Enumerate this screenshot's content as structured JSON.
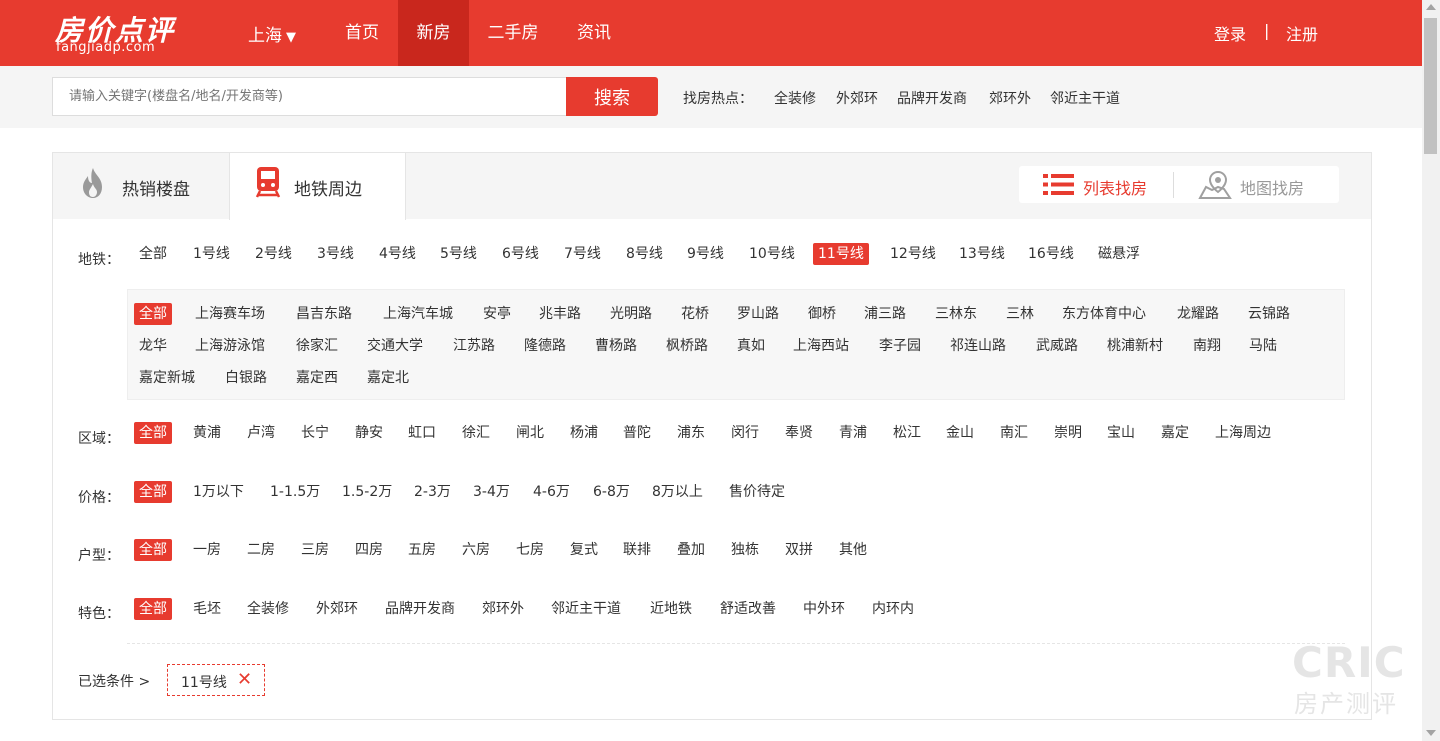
{
  "header": {
    "logo_cn": "房价点评",
    "logo_en": "fangjiadp.com",
    "city": "上海",
    "nav": [
      "首页",
      "新房",
      "二手房",
      "资讯"
    ],
    "login": "登录",
    "separator": "|",
    "register": "注册"
  },
  "search": {
    "placeholder": "请输入关键字(楼盘名/地名/开发商等)",
    "button": "搜索",
    "hot_label": "找房热点：",
    "hot_items": [
      "全装修",
      "外郊环",
      "品牌开发商",
      "郊环外",
      "邻近主干道"
    ]
  },
  "tabs": {
    "hot": "热销楼盘",
    "metro": "地铁周边",
    "list_view": "列表找房",
    "map_view": "地图找房"
  },
  "filters": {
    "metro_label": "地铁：",
    "metro_lines": [
      "全部",
      "1号线",
      "2号线",
      "3号线",
      "4号线",
      "5号线",
      "6号线",
      "7号线",
      "8号线",
      "9号线",
      "10号线",
      "11号线",
      "12号线",
      "13号线",
      "16号线",
      "磁悬浮"
    ],
    "stations": [
      "全部",
      "上海赛车场",
      "昌吉东路",
      "上海汽车城",
      "安亭",
      "兆丰路",
      "光明路",
      "花桥",
      "罗山路",
      "御桥",
      "浦三路",
      "三林东",
      "三林",
      "东方体育中心",
      "龙耀路",
      "云锦路",
      "龙华",
      "上海游泳馆",
      "徐家汇",
      "交通大学",
      "江苏路",
      "隆德路",
      "曹杨路",
      "枫桥路",
      "真如",
      "上海西站",
      "李子园",
      "祁连山路",
      "武威路",
      "桃浦新村",
      "南翔",
      "马陆",
      "嘉定新城",
      "白银路",
      "嘉定西",
      "嘉定北"
    ],
    "district_label": "区域：",
    "districts": [
      "全部",
      "黄浦",
      "卢湾",
      "长宁",
      "静安",
      "虹口",
      "徐汇",
      "闸北",
      "杨浦",
      "普陀",
      "浦东",
      "闵行",
      "奉贤",
      "青浦",
      "松江",
      "金山",
      "南汇",
      "崇明",
      "宝山",
      "嘉定",
      "上海周边"
    ],
    "price_label": "价格：",
    "prices": [
      "全部",
      "1万以下",
      "1-1.5万",
      "1.5-2万",
      "2-3万",
      "3-4万",
      "4-6万",
      "6-8万",
      "8万以上",
      "售价待定"
    ],
    "layout_label": "户型：",
    "layouts": [
      "全部",
      "一房",
      "二房",
      "三房",
      "四房",
      "五房",
      "六房",
      "七房",
      "复式",
      "联排",
      "叠加",
      "独栋",
      "双拼",
      "其他"
    ],
    "feature_label": "特色：",
    "features": [
      "全部",
      "毛坯",
      "全装修",
      "外郊环",
      "品牌开发商",
      "郊环外",
      "邻近主干道",
      "近地铁",
      "舒适改善",
      "中外环",
      "内环内"
    ]
  },
  "chosen": {
    "label": "已选条件 >",
    "tag": "11号线",
    "remove_icon": "✕"
  },
  "watermark": {
    "line1": "CRIC",
    "line2": "房产测评"
  },
  "colors": {
    "brand_red": "#e73b2f",
    "active_nav": "#c9271d"
  }
}
